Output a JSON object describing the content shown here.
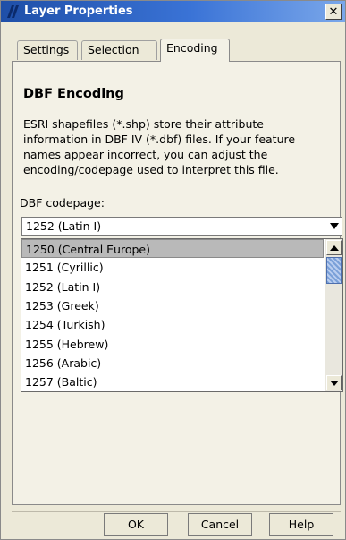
{
  "window": {
    "title": "Layer Properties",
    "close_label": "✕"
  },
  "tabs": [
    {
      "label": "Settings",
      "active": false
    },
    {
      "label": "Selection",
      "active": false
    },
    {
      "label": "Encoding",
      "active": true
    }
  ],
  "panel": {
    "heading": "DBF Encoding",
    "description": "ESRI shapefiles (*.shp) store their attribute information in DBF IV (*.dbf) files. If your feature names appear incorrect, you can adjust the encoding/codepage used to interpret this file.",
    "codepage_label": "DBF codepage:",
    "selected_value": "1252 (Latin I)"
  },
  "dropdown_options": [
    {
      "label": "1250 (Central Europe)",
      "highlighted": true
    },
    {
      "label": "1251 (Cyrillic)",
      "highlighted": false
    },
    {
      "label": "1252 (Latin I)",
      "highlighted": false
    },
    {
      "label": "1253 (Greek)",
      "highlighted": false
    },
    {
      "label": "1254 (Turkish)",
      "highlighted": false
    },
    {
      "label": "1255 (Hebrew)",
      "highlighted": false
    },
    {
      "label": "1256 (Arabic)",
      "highlighted": false
    },
    {
      "label": "1257 (Baltic)",
      "highlighted": false
    }
  ],
  "buttons": {
    "ok": "OK",
    "cancel": "Cancel",
    "help": "Help"
  },
  "colors": {
    "titlebar_start": "#1f4fa8",
    "titlebar_end": "#7aa7ea",
    "dialog_bg": "#ece9d8"
  }
}
